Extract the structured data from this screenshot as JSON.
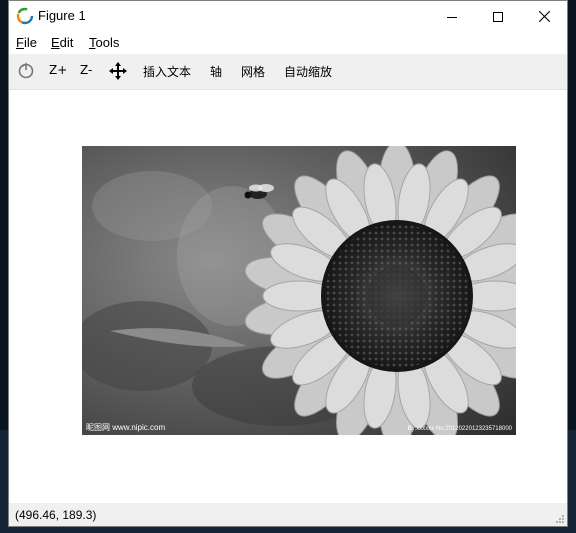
{
  "window": {
    "title": "Figure 1",
    "controls": {
      "minimize_icon": "minimize-icon",
      "maximize_icon": "maximize-icon",
      "close_icon": "close-icon"
    }
  },
  "menu": {
    "file": {
      "mnemonic": "F",
      "rest": "ile"
    },
    "edit": {
      "mnemonic": "E",
      "rest": "dit"
    },
    "tools": {
      "mnemonic": "T",
      "rest": "ools"
    }
  },
  "toolbar": {
    "home_icon": "home-icon",
    "zoom_in": "Z+",
    "zoom_out": "Z-",
    "pan_icon": "move-arrows-icon",
    "insert_text": "插入文本",
    "axis": "轴",
    "grid": "网格",
    "autoscale": "自动缩放"
  },
  "image": {
    "watermark_left": "昵图网 www.nipic.com",
    "watermark_right": "By:xxxxxx No.20120220123235718000"
  },
  "status": {
    "coords": "(496.46, 189.3)"
  }
}
